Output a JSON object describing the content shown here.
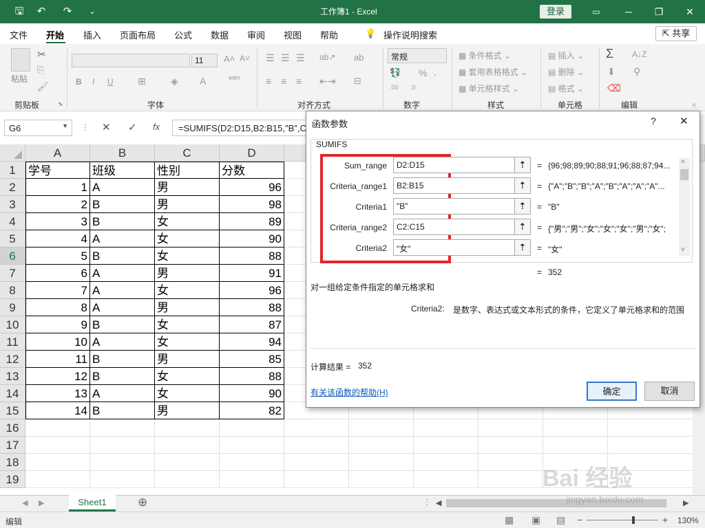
{
  "window": {
    "title": "工作簿1 - Excel",
    "login": "登录",
    "minimize": "─",
    "restore": "❐",
    "close": "✕"
  },
  "qat": {
    "save": "🖫",
    "undo": "↶",
    "redo": "↷",
    "more": "⌄"
  },
  "tabs": [
    "文件",
    "开始",
    "插入",
    "页面布局",
    "公式",
    "数据",
    "审阅",
    "视图",
    "帮助",
    "操作说明搜索"
  ],
  "share": "共享",
  "ribbon": {
    "groups": [
      "剪贴板",
      "字体",
      "对齐方式",
      "数字",
      "样式",
      "单元格",
      "编辑"
    ],
    "paste": "粘贴",
    "font_size": "11",
    "number_format": "常规",
    "bold": "B",
    "italic": "I",
    "underline": "U",
    "wen": "wén",
    "conditional": "条件格式",
    "table_format": "套用表格格式",
    "cell_style": "单元格样式",
    "insert": "插入",
    "delete": "删除",
    "format": "格式",
    "sum": "Σ"
  },
  "formula_bar": {
    "name_box": "G6",
    "cancel": "✕",
    "enter": "✓",
    "fx": "fx",
    "formula": "=SUMIFS(D2:D15,B2:B15,\"B\",C"
  },
  "grid": {
    "columns": [
      "A",
      "B",
      "C",
      "D"
    ],
    "rows": [
      "1",
      "2",
      "3",
      "4",
      "5",
      "6",
      "7",
      "8",
      "9",
      "10",
      "11",
      "12",
      "13",
      "14",
      "15",
      "16",
      "17",
      "18",
      "19"
    ],
    "header": [
      "学号",
      "班级",
      "性别",
      "分数"
    ],
    "data": [
      [
        "1",
        "A",
        "男",
        "96"
      ],
      [
        "2",
        "B",
        "男",
        "98"
      ],
      [
        "3",
        "B",
        "女",
        "89"
      ],
      [
        "4",
        "A",
        "女",
        "90"
      ],
      [
        "5",
        "B",
        "女",
        "88"
      ],
      [
        "6",
        "A",
        "男",
        "91"
      ],
      [
        "7",
        "A",
        "女",
        "96"
      ],
      [
        "8",
        "A",
        "男",
        "88"
      ],
      [
        "9",
        "B",
        "女",
        "87"
      ],
      [
        "10",
        "A",
        "女",
        "94"
      ],
      [
        "11",
        "B",
        "男",
        "85"
      ],
      [
        "12",
        "B",
        "女",
        "88"
      ],
      [
        "13",
        "A",
        "女",
        "90"
      ],
      [
        "14",
        "B",
        "男",
        "82"
      ]
    ]
  },
  "sheet_tab": "Sheet1",
  "add_sheet": "⊕",
  "status": {
    "mode": "编辑",
    "zoom": "130%",
    "minus": "−",
    "plus": "+"
  },
  "dialog": {
    "title": "函数参数",
    "help_q": "?",
    "close": "✕",
    "function_name": "SUMIFS",
    "args": [
      {
        "label": "Sum_range",
        "value": "D2:D15",
        "result": "{96;98;89;90;88;91;96;88;87;94..."
      },
      {
        "label": "Criteria_range1",
        "value": "B2:B15",
        "result": "{\"A\";\"B\";\"B\";\"A\";\"B\";\"A\";\"A\";\"A\"..."
      },
      {
        "label": "Criteria1",
        "value": "\"B\"",
        "result": "\"B\""
      },
      {
        "label": "Criteria_range2",
        "value": "C2:C15",
        "result": "{\"男\";\"男\";\"女\";\"女\";\"女\";\"男\";\"女\";"
      },
      {
        "label": "Criteria2",
        "value": "\"女\"",
        "result": "\"女\""
      }
    ],
    "eq": "=",
    "total": "352",
    "description": "对一组给定条件指定的单元格求和",
    "arg_help_label": "Criteria2:",
    "arg_help_text": "是数字、表达式或文本形式的条件，它定义了单元格求和的范围",
    "calc_label": "计算结果 =",
    "calc_value": "352",
    "help_link": "有关该函数的帮助(H)",
    "ok": "确定",
    "cancel": "取消"
  },
  "watermark": {
    "logo": "Bai 经验",
    "url": "jingyan.baidu.com"
  }
}
